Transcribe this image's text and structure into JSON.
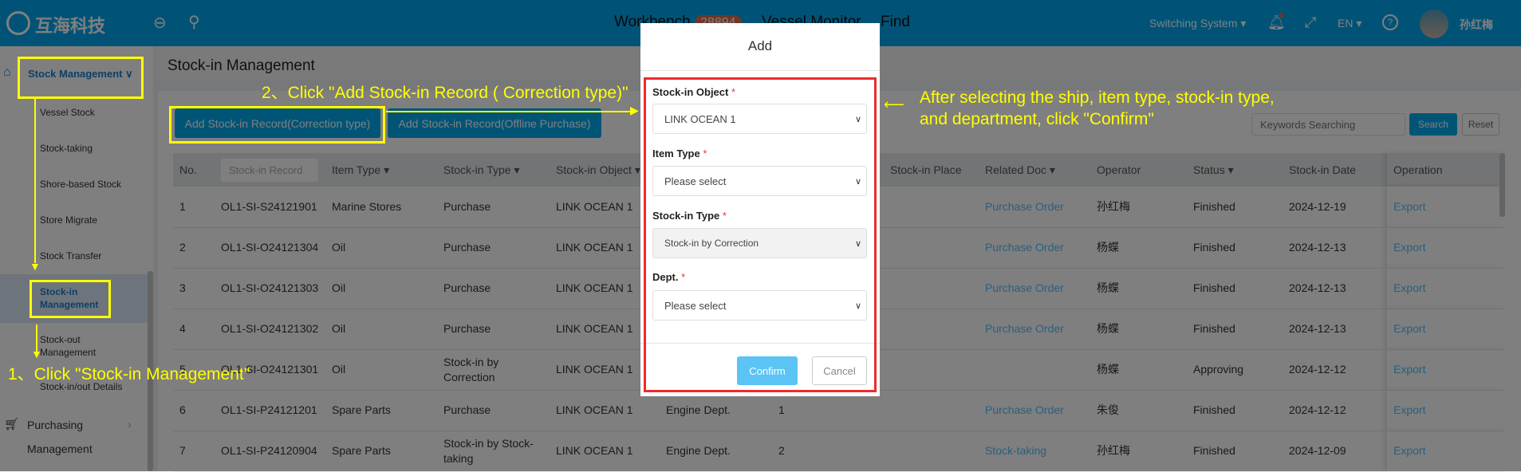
{
  "header": {
    "logo": "互海科技",
    "nav": [
      {
        "label": "Workbench",
        "badge": "28894"
      },
      {
        "label": "Vessel Monitor"
      },
      {
        "label": "Find"
      }
    ],
    "switch": "Switching System",
    "lang": "EN",
    "user": "孙红梅",
    "brand_color": "#00a6ef"
  },
  "sidebar": {
    "group": "Stock Management",
    "items": [
      "Vessel Stock",
      "Stock-taking",
      "Shore-based Stock",
      "Store Migrate",
      "Stock Transfer",
      "Stock-in Management",
      "Stock-out Management",
      "Stock-in/out Details"
    ],
    "group2": "Purchasing",
    "group2b": "Management"
  },
  "page": {
    "title": "Stock-in Management",
    "btn_correction": "Add Stock-in Record(Correction type)",
    "btn_offline": "Add Stock-in Record(Offline Purchase)",
    "search_placeholder": "Keywords Searching",
    "search": "Search",
    "reset": "Reset"
  },
  "table": {
    "headers": [
      "No.",
      "Stock-in Record",
      "Item Type ▾",
      "Stock-in Type ▾",
      "Stock-in Object ▾",
      "",
      "",
      "Stock-in Place",
      "Related Doc ▾",
      "Operator",
      "Status ▾",
      "Stock-in Date",
      "Operation"
    ],
    "rows": [
      [
        "1",
        "OL1-SI-S24121901",
        "Marine Stores",
        "Purchase",
        "LINK OCEAN 1",
        "",
        "",
        "",
        "Purchase Order",
        "孙红梅",
        "Finished",
        "2024-12-19",
        "Export"
      ],
      [
        "2",
        "OL1-SI-O24121304",
        "Oil",
        "Purchase",
        "LINK OCEAN 1",
        "",
        "",
        "",
        "Purchase Order",
        "杨蝶",
        "Finished",
        "2024-12-13",
        "Export"
      ],
      [
        "3",
        "OL1-SI-O24121303",
        "Oil",
        "Purchase",
        "LINK OCEAN 1",
        "",
        "",
        "",
        "Purchase Order",
        "杨蝶",
        "Finished",
        "2024-12-13",
        "Export"
      ],
      [
        "4",
        "OL1-SI-O24121302",
        "Oil",
        "Purchase",
        "LINK OCEAN 1",
        "",
        "",
        "",
        "Purchase Order",
        "杨蝶",
        "Finished",
        "2024-12-13",
        "Export"
      ],
      [
        "5",
        "OL1-SI-O24121301",
        "Oil",
        "Stock-in by Correction",
        "LINK OCEAN 1",
        "",
        "",
        "",
        "",
        "杨蝶",
        "Approving",
        "2024-12-12",
        "Export"
      ],
      [
        "6",
        "OL1-SI-P24121201",
        "Spare Parts",
        "Purchase",
        "LINK OCEAN 1",
        "Engine Dept.",
        "1",
        "",
        "Purchase Order",
        "朱俊",
        "Finished",
        "2024-12-12",
        "Export"
      ],
      [
        "7",
        "OL1-SI-P24120904",
        "Spare Parts",
        "Stock-in by Stock-taking",
        "LINK OCEAN 1",
        "Engine Dept.",
        "2",
        "",
        "Stock-taking",
        "孙红梅",
        "Finished",
        "2024-12-09",
        "Export"
      ]
    ]
  },
  "modal": {
    "title": "Add",
    "f1_label": "Stock-in Object",
    "f1_value": "LINK OCEAN 1",
    "f2_label": "Item Type",
    "f2_value": "Please select",
    "f3_label": "Stock-in Type",
    "f3_value": "Stock-in by Correction",
    "f4_label": "Dept.",
    "f4_value": "Please select",
    "required": "*",
    "confirm": "Confirm",
    "cancel": "Cancel"
  },
  "annotations": {
    "step1": "1、Click \"Stock-in Management\"",
    "step2": "2、Click \"Add Stock-in Record ( Correction type)\"",
    "step3a": "After selecting the ship, item type, stock-in type,",
    "step3b": " and department, click \"Confirm\""
  }
}
